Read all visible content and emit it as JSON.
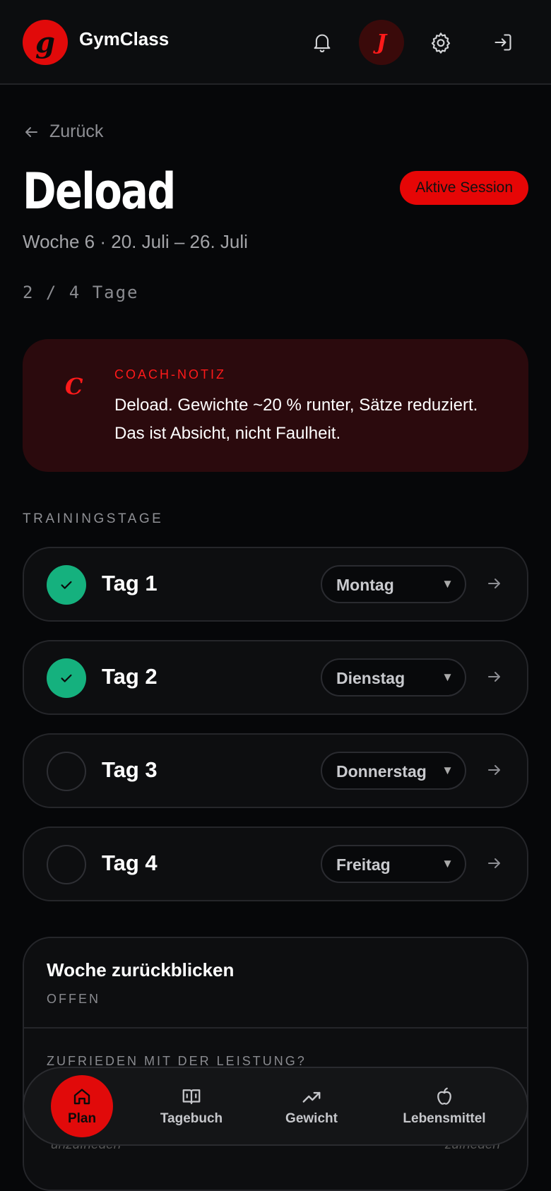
{
  "header": {
    "logo_letter": "g",
    "app_title": "GymClass",
    "avatar_letter": "J"
  },
  "back_label": "Zurück",
  "page": {
    "title": "Deload",
    "session_badge": "Aktive Session",
    "week_info": "Woche 6 · 20. Juli – 26. Juli",
    "progress": "2 / 4 Tage"
  },
  "coach_note": {
    "icon_letter": "C",
    "label": "COACH-NOTIZ",
    "text": "Deload. Gewichte ~20 % runter, Sätze reduziert. Das ist Absicht, nicht Faulheit."
  },
  "section_label": "TRAININGSTAGE",
  "days": [
    {
      "label": "Tag 1",
      "weekday": "Montag",
      "done": true
    },
    {
      "label": "Tag 2",
      "weekday": "Dienstag",
      "done": true
    },
    {
      "label": "Tag 3",
      "weekday": "Donnerstag",
      "done": false
    },
    {
      "label": "Tag 4",
      "weekday": "Freitag",
      "done": false
    }
  ],
  "review": {
    "title": "Woche zurückblicken",
    "status": "OFFEN",
    "question": "ZUFRIEDEN MIT DER LEISTUNG?",
    "scale_low": "unzufrieden",
    "scale_high": "zufrieden"
  },
  "nav": {
    "items": [
      {
        "label": "Plan",
        "icon": "home-icon",
        "active": true
      },
      {
        "label": "Tagebuch",
        "icon": "book-icon",
        "active": false
      },
      {
        "label": "Gewicht",
        "icon": "trend-icon",
        "active": false
      },
      {
        "label": "Lebensmittel",
        "icon": "apple-icon",
        "active": false
      }
    ]
  },
  "colors": {
    "accent": "#e10a0a",
    "success": "#15b17e",
    "background": "#060709",
    "coach_bg": "#2b0a0d"
  }
}
